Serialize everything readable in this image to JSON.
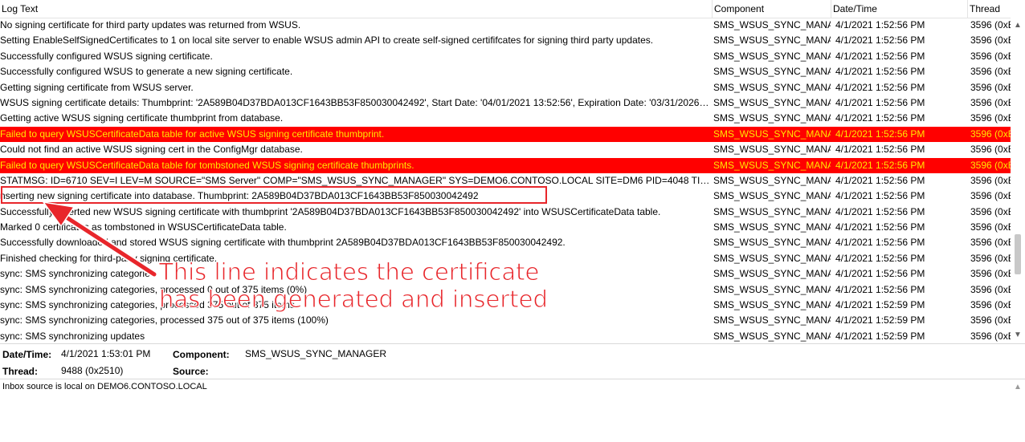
{
  "columns": {
    "log_text": "Log Text",
    "component": "Component",
    "date_time": "Date/Time",
    "thread": "Thread"
  },
  "rows": [
    {
      "text": "No signing certificate for third party updates was returned from WSUS.",
      "component": "SMS_WSUS_SYNC_MANAG",
      "datetime": "4/1/2021 1:52:56 PM",
      "thread": "3596 (0xE",
      "error": false
    },
    {
      "text": "Setting EnableSelfSignedCertificates to 1 on local site server to enable WSUS admin API to create self-signed certififcates for signing third party updates.",
      "component": "SMS_WSUS_SYNC_MANAG",
      "datetime": "4/1/2021 1:52:56 PM",
      "thread": "3596 (0xE",
      "error": false
    },
    {
      "text": "Successfully configured WSUS signing certificate.",
      "component": "SMS_WSUS_SYNC_MANAG",
      "datetime": "4/1/2021 1:52:56 PM",
      "thread": "3596 (0xE",
      "error": false
    },
    {
      "text": "Successfully configured WSUS to generate a new signing certificate.",
      "component": "SMS_WSUS_SYNC_MANAG",
      "datetime": "4/1/2021 1:52:56 PM",
      "thread": "3596 (0xE",
      "error": false
    },
    {
      "text": "Getting signing certificate from WSUS server.",
      "component": "SMS_WSUS_SYNC_MANAG",
      "datetime": "4/1/2021 1:52:56 PM",
      "thread": "3596 (0xE",
      "error": false
    },
    {
      "text": "WSUS signing certificate details: Thumbprint: '2A589B04D37BDA013CF1643BB53F850030042492', Start Date: '04/01/2021 13:52:56', Expiration Date: '03/31/2026 13:...",
      "component": "SMS_WSUS_SYNC_MANAG",
      "datetime": "4/1/2021 1:52:56 PM",
      "thread": "3596 (0xE",
      "error": false
    },
    {
      "text": "Getting active WSUS signing certificate thumbprint from database.",
      "component": "SMS_WSUS_SYNC_MANAG",
      "datetime": "4/1/2021 1:52:56 PM",
      "thread": "3596 (0xE",
      "error": false
    },
    {
      "text": "Failed to query WSUSCertificateData table for active WSUS signing certificate thumbprint.",
      "component": "SMS_WSUS_SYNC_MANAG",
      "datetime": "4/1/2021 1:52:56 PM",
      "thread": "3596 (0xE",
      "error": true
    },
    {
      "text": "Could not find an active WSUS signing cert in the ConfigMgr database.",
      "component": "SMS_WSUS_SYNC_MANAG",
      "datetime": "4/1/2021 1:52:56 PM",
      "thread": "3596 (0xE",
      "error": false
    },
    {
      "text": "Failed to query WSUSCertificateData table for tombstoned WSUS signing certificate thumbprints.",
      "component": "SMS_WSUS_SYNC_MANAG",
      "datetime": "4/1/2021 1:52:56 PM",
      "thread": "3596 (0xE",
      "error": true
    },
    {
      "text": "STATMSG: ID=6710 SEV=I LEV=M SOURCE=\"SMS Server\" COMP=\"SMS_WSUS_SYNC_MANAGER\" SYS=DEMO6.CONTOSO.LOCAL SITE=DM6 PID=4048 TID=3596 G...",
      "component": "SMS_WSUS_SYNC_MANAG",
      "datetime": "4/1/2021 1:52:56 PM",
      "thread": "3596 (0xE",
      "error": false
    },
    {
      "text": "nserting new signing certificate into database. Thumbprint: 2A589B04D37BDA013CF1643BB53F850030042492",
      "component": "SMS_WSUS_SYNC_MANAG",
      "datetime": "4/1/2021 1:52:56 PM",
      "thread": "3596 (0xE",
      "error": false
    },
    {
      "text": "Successfully inserted new WSUS signing certificate with thumbprint '2A589B04D37BDA013CF1643BB53F850030042492' into WSUSCertificateData table.",
      "component": "SMS_WSUS_SYNC_MANAG",
      "datetime": "4/1/2021 1:52:56 PM",
      "thread": "3596 (0xE",
      "error": false
    },
    {
      "text": "Marked 0 certificates as tombstoned in WSUSCertificateData table.",
      "component": "SMS_WSUS_SYNC_MANAG",
      "datetime": "4/1/2021 1:52:56 PM",
      "thread": "3596 (0xE",
      "error": false
    },
    {
      "text": "Successfully downloaded and stored WSUS signing certificate with thumbprint 2A589B04D37BDA013CF1643BB53F850030042492.",
      "component": "SMS_WSUS_SYNC_MANAG",
      "datetime": "4/1/2021 1:52:56 PM",
      "thread": "3596 (0xE",
      "error": false
    },
    {
      "text": "Finished checking for third-party signing certificate.",
      "component": "SMS_WSUS_SYNC_MANAG",
      "datetime": "4/1/2021 1:52:56 PM",
      "thread": "3596 (0xE",
      "error": false
    },
    {
      "text": "sync: SMS synchronizing categories",
      "component": "SMS_WSUS_SYNC_MANAG",
      "datetime": "4/1/2021 1:52:56 PM",
      "thread": "3596 (0xE",
      "error": false
    },
    {
      "text": "sync: SMS synchronizing categories, processed 0 out of 375 items (0%)",
      "component": "SMS_WSUS_SYNC_MANAG",
      "datetime": "4/1/2021 1:52:56 PM",
      "thread": "3596 (0xE",
      "error": false
    },
    {
      "text": "sync: SMS synchronizing categories, processed 375 out of 375 items",
      "component": "SMS_WSUS_SYNC_MANAG",
      "datetime": "4/1/2021 1:52:59 PM",
      "thread": "3596 (0xE",
      "error": false
    },
    {
      "text": "sync: SMS synchronizing categories, processed 375 out of 375 items (100%)",
      "component": "SMS_WSUS_SYNC_MANAG",
      "datetime": "4/1/2021 1:52:59 PM",
      "thread": "3596 (0xE",
      "error": false
    },
    {
      "text": "sync: SMS synchronizing updates",
      "component": "SMS_WSUS_SYNC_MANAG",
      "datetime": "4/1/2021 1:52:59 PM",
      "thread": "3596 (0xE",
      "error": false
    }
  ],
  "details": {
    "datetime_label": "Date/Time:",
    "datetime_value": "4/1/2021 1:53:01 PM",
    "component_label": "Component:",
    "component_value": "SMS_WSUS_SYNC_MANAGER",
    "thread_label": "Thread:",
    "thread_value": "9488 (0x2510)",
    "source_label": "Source:",
    "source_value": ""
  },
  "message": "Inbox source is local on DEMO6.CONTOSO.LOCAL",
  "annotation": {
    "line1": "This line indicates the certificate",
    "line2": "has been generated and inserted",
    "color": "#e8262b"
  },
  "colors": {
    "error_bg": "#ff0000",
    "error_text": "#ffe600"
  },
  "icons": {
    "scroll_up": "chevron-up-icon",
    "scroll_down": "chevron-down-icon"
  }
}
